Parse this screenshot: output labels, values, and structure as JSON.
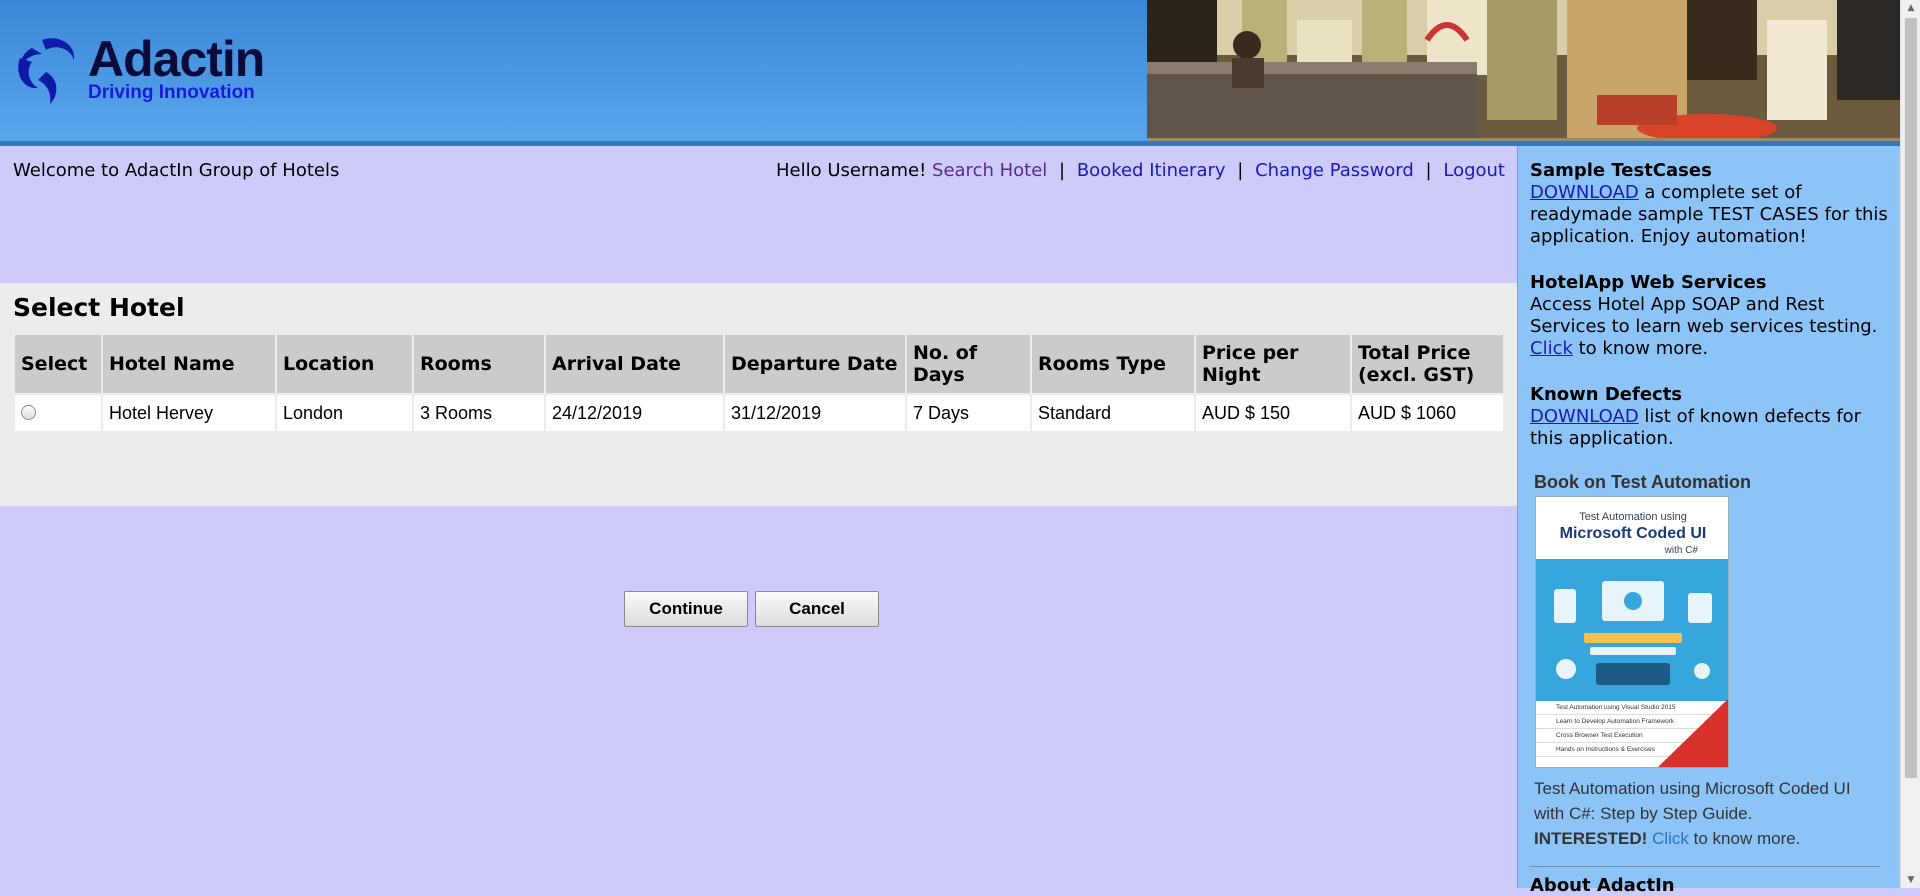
{
  "header": {
    "brand": "Adactin",
    "tagline": "Driving Innovation"
  },
  "nav": {
    "welcome": "Welcome to AdactIn Group of Hotels",
    "greeting": "Hello Username!",
    "links": [
      "Search Hotel",
      "Booked Itinerary",
      "Change Password",
      "Logout"
    ]
  },
  "select_hotel": {
    "title": "Select Hotel",
    "columns": [
      "Select",
      "Hotel Name",
      "Location",
      "Rooms",
      "Arrival Date",
      "Departure Date",
      "No. of Days",
      "Rooms Type",
      "Price per Night",
      "Total Price (excl. GST)"
    ],
    "rows": [
      {
        "hotel_name": "Hotel Hervey",
        "location": "London",
        "rooms": "3 Rooms",
        "arrival": "24/12/2019",
        "departure": "31/12/2019",
        "days": "7 Days",
        "room_type": "Standard",
        "price_per_night": "AUD $ 150",
        "total_price": "AUD $ 1060",
        "selected": false
      }
    ],
    "continue_label": "Continue",
    "cancel_label": "Cancel"
  },
  "sidebar": {
    "testcases": {
      "title": "Sample TestCases",
      "link": "DOWNLOAD",
      "text": " a complete set of readymade sample TEST CASES for this application. Enjoy automation!"
    },
    "webservices": {
      "title": "HotelApp Web Services",
      "text": "Access Hotel App SOAP and Rest Services to learn web services testing.",
      "link": "Click",
      "text2": " to know more."
    },
    "defects": {
      "title": "Known Defects",
      "link": "DOWNLOAD",
      "text": " list of known defects for this application."
    },
    "book": {
      "heading": "Book on Test Automation",
      "cover_line1": "Test Automation using",
      "cover_line2": "Microsoft Coded UI",
      "cover_line3": "with C#",
      "caption": "Test Automation using Microsoft Coded UI with C#: Step by Step Guide.",
      "interested": "INTERESTED!",
      "link": "Click",
      "tail": " to know more."
    },
    "about": "About AdactIn"
  }
}
